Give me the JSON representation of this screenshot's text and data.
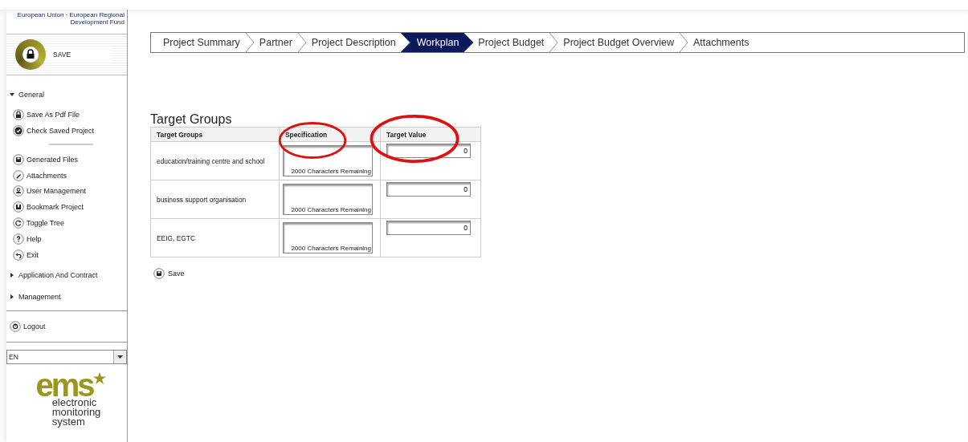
{
  "funding_note": "European Union · European Regional Development Fund",
  "save_button": {
    "label": "SAVE"
  },
  "sidebar": {
    "sections": [
      {
        "label": "General",
        "expanded": true,
        "groups": [
          [
            {
              "label": "Save As Pdf File"
            },
            {
              "label": "Check Saved Project"
            }
          ],
          [
            {
              "label": "Generated Files"
            },
            {
              "label": "Attachments"
            },
            {
              "label": "User Management"
            },
            {
              "label": "Bookmark Project"
            },
            {
              "label": "Toggle Tree"
            },
            {
              "label": "Help"
            },
            {
              "label": "Exit"
            }
          ]
        ]
      },
      {
        "label": "Application And Contract",
        "expanded": false
      },
      {
        "label": "Management",
        "expanded": false
      }
    ]
  },
  "logout": {
    "label": "Logout"
  },
  "language": {
    "value": "EN"
  },
  "logo": {
    "wordmark": "ems",
    "tagline": [
      "electronic",
      "monitoring",
      "system"
    ]
  },
  "steps": [
    {
      "label": "Project Summary",
      "selected": false
    },
    {
      "label": "Partner",
      "selected": false
    },
    {
      "label": "Project Description",
      "selected": false
    },
    {
      "label": "Workplan",
      "selected": true
    },
    {
      "label": "Project Budget",
      "selected": false
    },
    {
      "label": "Project Budget Overview",
      "selected": false
    },
    {
      "label": "Attachments",
      "selected": false
    }
  ],
  "section_title": "Target Groups",
  "table": {
    "columns": [
      {
        "label": "Target Groups",
        "circled": false
      },
      {
        "label": "Specification",
        "circled": true
      },
      {
        "label": "Target Value",
        "circled": true
      }
    ],
    "rows": [
      {
        "group": "education/training centre and school",
        "counter": "2000 Characters Remaining",
        "target_value": "0"
      },
      {
        "group": "business support organisation",
        "counter": "2000 Characters Remaining",
        "target_value": "0"
      },
      {
        "group": "EEIG, EGTC",
        "counter": "2000 Characters Remaining",
        "target_value": "0"
      }
    ]
  },
  "save_link": {
    "label": "Save"
  }
}
